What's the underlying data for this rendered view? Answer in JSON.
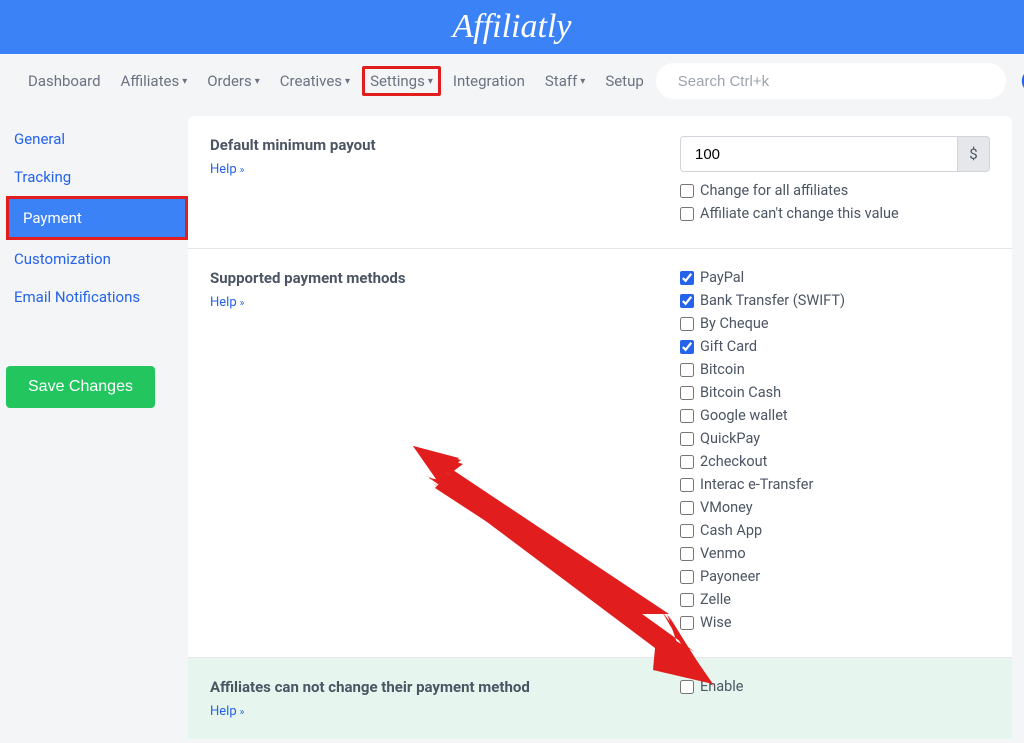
{
  "brand": "Affiliatly",
  "nav": {
    "items": [
      {
        "label": "Dashboard",
        "dropdown": false
      },
      {
        "label": "Affiliates",
        "dropdown": true
      },
      {
        "label": "Orders",
        "dropdown": true
      },
      {
        "label": "Creatives",
        "dropdown": true
      },
      {
        "label": "Settings",
        "dropdown": true,
        "highlighted": true
      },
      {
        "label": "Integration",
        "dropdown": false
      },
      {
        "label": "Staff",
        "dropdown": true
      },
      {
        "label": "Setup",
        "dropdown": false
      }
    ],
    "search_placeholder": "Search Ctrl+k"
  },
  "sidebar": {
    "items": [
      {
        "label": "General"
      },
      {
        "label": "Tracking"
      },
      {
        "label": "Payment",
        "active": true
      },
      {
        "label": "Customization"
      },
      {
        "label": "Email Notifications"
      }
    ],
    "save_label": "Save Changes"
  },
  "sections": {
    "min_payout": {
      "title": "Default minimum payout",
      "help": "Help",
      "value": "100",
      "currency": "$",
      "change_all_label": "Change for all affiliates",
      "cant_change_label": "Affiliate can't change this value"
    },
    "methods": {
      "title": "Supported payment methods",
      "help": "Help",
      "options": [
        {
          "label": "PayPal",
          "checked": true
        },
        {
          "label": "Bank Transfer (SWIFT)",
          "checked": true
        },
        {
          "label": "By Cheque",
          "checked": false
        },
        {
          "label": "Gift Card",
          "checked": true
        },
        {
          "label": "Bitcoin",
          "checked": false
        },
        {
          "label": "Bitcoin Cash",
          "checked": false
        },
        {
          "label": "Google wallet",
          "checked": false
        },
        {
          "label": "QuickPay",
          "checked": false
        },
        {
          "label": "2checkout",
          "checked": false
        },
        {
          "label": "Interac e-Transfer",
          "checked": false
        },
        {
          "label": "VMoney",
          "checked": false
        },
        {
          "label": "Cash App",
          "checked": false
        },
        {
          "label": "Venmo",
          "checked": false
        },
        {
          "label": "Payoneer",
          "checked": false
        },
        {
          "label": "Zelle",
          "checked": false
        },
        {
          "label": "Wise",
          "checked": false
        }
      ]
    },
    "lock_method": {
      "title": "Affiliates can not change their payment method",
      "help": "Help",
      "enable_label": "Enable"
    }
  }
}
